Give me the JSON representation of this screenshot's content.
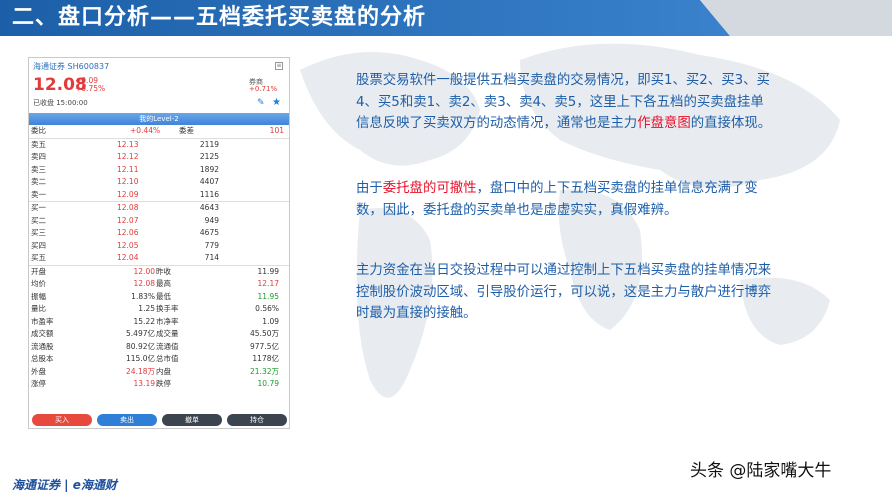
{
  "slide": {
    "title": "二、盘口分析——五档委托买卖盘的分析"
  },
  "app": {
    "stock_name": "海通证券  SH600837",
    "price": "12.08",
    "change": "+0.09",
    "change_pct": "+0.75%",
    "sector_name": "券商",
    "sector_change": "+0.71%",
    "status": "已收盘  15:00:00",
    "level_tab": "我的Level-2",
    "weibi": {
      "label": "委比",
      "pct": "+0.44%",
      "label2": "委差",
      "value": "101"
    },
    "sells": [
      {
        "label": "卖五",
        "price": "12.13",
        "vol": "2119"
      },
      {
        "label": "卖四",
        "price": "12.12",
        "vol": "2125"
      },
      {
        "label": "卖三",
        "price": "12.11",
        "vol": "1892"
      },
      {
        "label": "卖二",
        "price": "12.10",
        "vol": "4407"
      },
      {
        "label": "卖一",
        "price": "12.09",
        "vol": "1116"
      }
    ],
    "buys": [
      {
        "label": "买一",
        "price": "12.08",
        "vol": "4643"
      },
      {
        "label": "买二",
        "price": "12.07",
        "vol": "949"
      },
      {
        "label": "买三",
        "price": "12.06",
        "vol": "4675"
      },
      {
        "label": "买四",
        "price": "12.05",
        "vol": "779"
      },
      {
        "label": "买五",
        "price": "12.04",
        "vol": "714"
      }
    ],
    "stats": [
      {
        "l1": "开盘",
        "v1": "12.00",
        "l2": "昨收",
        "v2": "11.99"
      },
      {
        "l1": "均价",
        "v1": "12.08",
        "l2": "最高",
        "v2": "12.17"
      },
      {
        "l1": "振幅",
        "v1": "1.83%",
        "l2": "最低",
        "v2": "11.95"
      },
      {
        "l1": "量比",
        "v1": "1.25",
        "l2": "换手率",
        "v2": "0.56%"
      },
      {
        "l1": "市盈率",
        "v1": "15.22",
        "l2": "市净率",
        "v2": "1.09"
      },
      {
        "l1": "成交额",
        "v1": "5.497亿",
        "l2": "成交量",
        "v2": "45.50万"
      },
      {
        "l1": "流通股",
        "v1": "80.92亿",
        "l2": "流通值",
        "v2": "977.5亿"
      },
      {
        "l1": "总股本",
        "v1": "115.0亿",
        "l2": "总市值",
        "v2": "1178亿"
      },
      {
        "l1": "外盘",
        "v1": "24.18万",
        "l2": "内盘",
        "v2": "21.32万"
      },
      {
        "l1": "涨停",
        "v1": "13.19",
        "l2": "跌停",
        "v2": "10.79"
      }
    ],
    "buttons": {
      "buy": "买入",
      "sell": "卖出",
      "cancel": "撤单",
      "hold": "持仓"
    },
    "menu_icon": "menu-icon",
    "colors": {
      "up": "#e23b3b",
      "down": "#1a9c2b",
      "accent": "#1e7fd8"
    }
  },
  "text": {
    "p1_a": "股票交易软件一般提供五档买卖盘的交易情况，即买1、买2、买3、买4、买5和卖1、卖2、卖3、卖4、卖5，这里上下各五档的买卖盘挂单信息反映了买卖双方的动态情况，通常也是主力",
    "p1_hl": "作盘意图",
    "p1_b": "的直接体现。",
    "p2_a": "由于",
    "p2_hl": "委托盘的可撤性",
    "p2_b": "，盘口中的上下五档买卖盘的挂单信息充满了变数，因此，委托盘的买卖单也是虚虚实实，真假难辨。",
    "p3": "主力资金在当日交投过程中可以通过控制上下五档买卖盘的挂单情况来控制股价波动区域、引导股价运行，可以说，这是主力与散户进行博弈时最为直接的接触。"
  },
  "footer": {
    "logo": "海通证券 | e海通财",
    "watermark": "头条 @陆家嘴大牛"
  }
}
